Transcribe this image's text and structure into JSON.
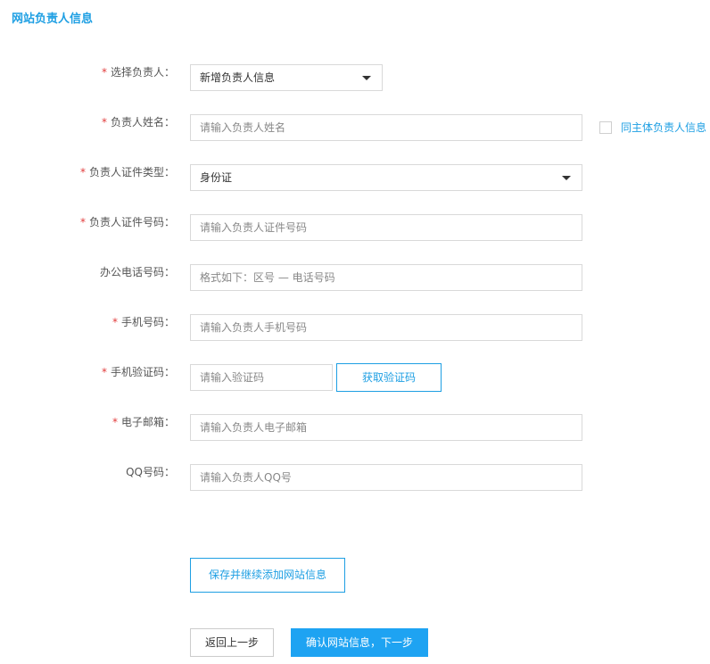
{
  "section_title": "网站负责人信息",
  "required_mark": "*",
  "fields": {
    "owner_select": {
      "label": "选择负责人：",
      "value": "新增负责人信息"
    },
    "owner_name": {
      "label": "负责人姓名：",
      "placeholder": "请输入负责人姓名"
    },
    "same_as_subject": {
      "label": "同主体负责人信息",
      "checked": false
    },
    "id_type": {
      "label": "负责人证件类型：",
      "value": "身份证"
    },
    "id_number": {
      "label": "负责人证件号码：",
      "placeholder": "请输入负责人证件号码"
    },
    "office_phone": {
      "label": "办公电话号码：",
      "placeholder": "格式如下：区号 — 电话号码"
    },
    "mobile": {
      "label": "手机号码：",
      "placeholder": "请输入负责人手机号码"
    },
    "sms_code": {
      "label": "手机验证码：",
      "placeholder": "请输入验证码",
      "button": "获取验证码"
    },
    "email": {
      "label": "电子邮箱：",
      "placeholder": "请输入负责人电子邮箱"
    },
    "qq": {
      "label": "QQ号码：",
      "placeholder": "请输入负责人QQ号"
    }
  },
  "buttons": {
    "save_continue": "保存并继续添加网站信息",
    "back": "返回上一步",
    "confirm_next": "确认网站信息，下一步"
  },
  "colors": {
    "accent": "#1e9fe3",
    "primary_button": "#1ea3f2",
    "required": "#e23b3b",
    "border": "#d9d9d9"
  }
}
